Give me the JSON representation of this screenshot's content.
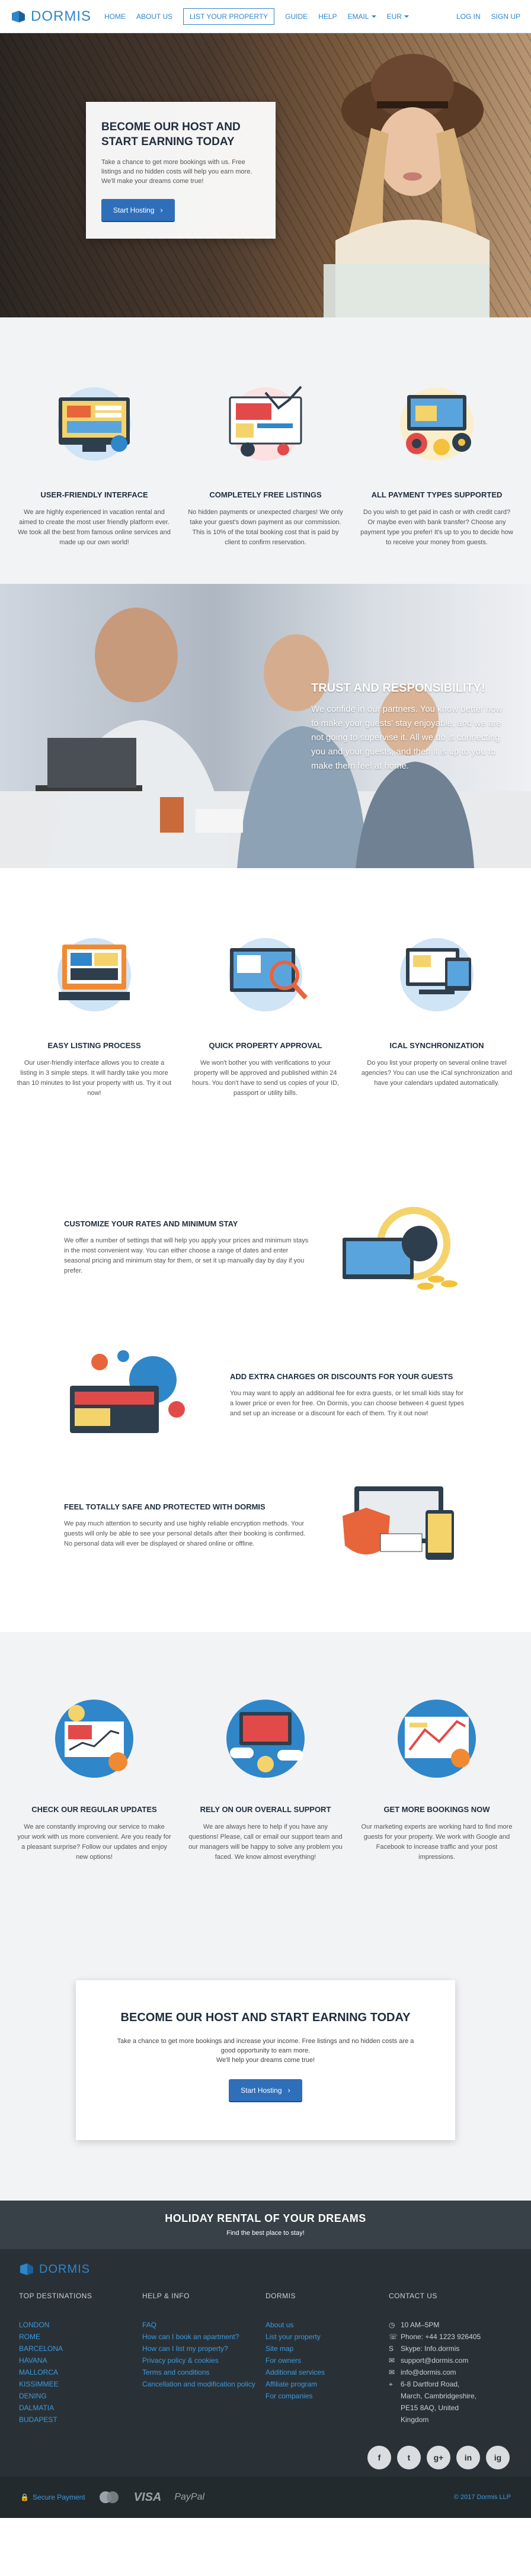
{
  "brand": {
    "name": "DORMIS"
  },
  "header": {
    "nav": [
      "HOME",
      "ABOUT US",
      "LIST YOUR PROPERTY",
      "GUIDE",
      "HELP",
      "EMAIL",
      "EUR"
    ],
    "right": [
      "LOG IN",
      "SIGN UP"
    ]
  },
  "hero": {
    "title": "BECOME OUR HOST AND START EARNING TODAY",
    "text": "Take a chance to get more bookings with us. Free listings and no hidden costs will help you earn more. We'll make your dreams come true!",
    "button": "Start Hosting"
  },
  "features1": [
    {
      "title": "USER-FRIENDLY INTERFACE",
      "text": "We are highly experienced in vacation rental and aimed to create the most user friendly platform ever. We took all the best from famous online services and made up our own world!"
    },
    {
      "title": "COMPLETELY FREE LISTINGS",
      "text": "No hidden payments or unexpected charges! We only take your guest's down payment as our commission. This is 10% of the total booking cost that is paid by client to confirm reservation."
    },
    {
      "title": "ALL PAYMENT TYPES SUPPORTED",
      "text": "Do you wish to get paid in cash or with credit card? Or maybe even with bank transfer? Choose any payment type you prefer! It's up to you to decide how to receive your money from guests."
    }
  ],
  "trust": {
    "title": "TRUST AND RESPONSIBILITY!",
    "text": "We confide in our partners. You know better how to make your guests' stay enjoyable, and we are not going to supervise it. All we do is connecting you and your guests, and then it is up to you to make them feel at home."
  },
  "features2": [
    {
      "title": "EASY LISTING PROCESS",
      "text": "Our user-friendly interface allows you to create a listing in 3 simple steps. It will hardly take you more than 10 minutes to list your property with us. Try it out now!"
    },
    {
      "title": "QUICK PROPERTY APPROVAL",
      "text": "We won't bother you with verifications to your property will be approved and published within 24 hours. You don't have to send us copies of your ID, passport or utility bills."
    },
    {
      "title": "ICAL SYNCHRONIZATION",
      "text": "Do you list your property on several online travel agencies? You can use the iCal synchronization and have your calendars updated automatically."
    }
  ],
  "rows": [
    {
      "title": "CUSTOMIZE YOUR RATES AND MINIMUM STAY",
      "text": "We offer a number of settings that will help you apply your prices and minimum stays in the most convenient way. You can either choose a range of dates and enter seasonal pricing and minimum stay for them, or set it up manually day by day if you prefer."
    },
    {
      "title": "ADD EXTRA CHARGES OR DISCOUNTS FOR YOUR GUESTS",
      "text": "You may want to apply an additional fee for extra guests, or let small kids stay for a lower price or even for free. On Dormis, you can choose between 4 guest types and set up an increase or a discount for each of them. Try it out now!"
    },
    {
      "title": "FEEL TOTALLY SAFE AND PROTECTED WITH DORMIS",
      "text": "We pay much attention to security and use highly reliable encryption methods. Your guests will only be able to see your personal details after their booking is confirmed. No personal data will ever be displayed or shared online or offline."
    }
  ],
  "features3": [
    {
      "title": "CHECK OUR REGULAR UPDATES",
      "text": "We are constantly improving our service to make your work with us more convenient. Are you ready for a pleasant surprise? Follow our updates and enjoy new options!"
    },
    {
      "title": "RELY ON OUR OVERALL SUPPORT",
      "text": "We are always here to help if you have any questions! Please, call or email our support team and our managers will be happy to solve any problem you faced. We know almost everything!"
    },
    {
      "title": "GET MORE BOOKINGS NOW",
      "text": "Our marketing experts are working hard to find more guests for your property. We work with Google and Facebook to increase traffic and your post impressions."
    }
  ],
  "cta": {
    "title": "BECOME OUR HOST AND START EARNING TODAY",
    "text1": "Take a chance to get more bookings and increase your income. Free listings and no hidden costs are a good opportunity to earn more.",
    "text2": "We'll help your dreams come true!",
    "button": "Start Hosting"
  },
  "holiday": {
    "title": "HOLIDAY RENTAL OF YOUR DREAMS",
    "subtitle": "Find the best place to stay!"
  },
  "footer": {
    "brand": "DORMIS",
    "destinations": {
      "heading": "TOP DESTINATIONS",
      "items": [
        "LONDON",
        "ROME",
        "BARCELONA",
        "HAVANA",
        "MALLORCA",
        "KISSIMMEE",
        "DENING",
        "DALMATIA",
        "BUDAPEST"
      ]
    },
    "help": {
      "heading": "HELP & INFO",
      "items": [
        "FAQ",
        "How can I book an apartment?",
        "How can I list my property?",
        "Privacy policy & cookies",
        "Terms and conditions",
        "Cancellation and modification policy"
      ]
    },
    "dormis": {
      "heading": "DORMIS",
      "items": [
        "About us",
        "List your property",
        "Site map",
        "For owners",
        "Additional services",
        "Affiliate program",
        "For companies"
      ]
    },
    "contact": {
      "heading": "CONTACT US",
      "items": [
        {
          "icon": "clock",
          "text": "10 AM–5PM"
        },
        {
          "icon": "phone",
          "text": "Phone: +44 1223 926405"
        },
        {
          "icon": "skype",
          "text": "Skype: Info.dormis"
        },
        {
          "icon": "mail",
          "text": "support@dormis.com"
        },
        {
          "icon": "mail",
          "text": "info@dormis.com"
        },
        {
          "icon": "pin",
          "text": "6-8 Dartford Road, March, Cambridgeshire, PE15 8AQ, United Kingdom"
        }
      ]
    },
    "socials": [
      "f",
      "t",
      "g+",
      "in",
      "ig"
    ],
    "secure": "Secure Payment",
    "payments": [
      "VISA",
      "PayPal"
    ],
    "copyright": "© 2017 Dormis LLP"
  },
  "colors": {
    "accent": "#2f86c9",
    "button": "#2f6fba",
    "footer": "#2a3136"
  }
}
